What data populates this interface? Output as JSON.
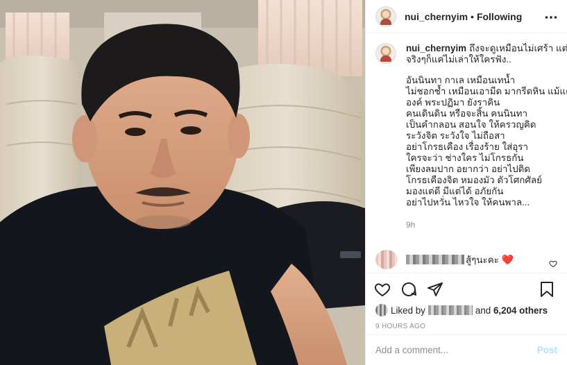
{
  "post": {
    "username": "nui_chernyim",
    "separator": "•",
    "follow_state": "Following",
    "caption": {
      "username": "nui_chernyim",
      "intro": "ถึงจะดูเหมือนไม่เศร้า แต่ จริงๆก็แค่ไม่เล่าให้ใครฟัง..",
      "lines": [
        "อันนินทา กาเล เหมือนเทน้ำ",
        "ไม่ชอกช้ำ เหมือนเอามีด มากรีดหิน แม้แต่",
        "องค์ พระปฏิมา ยังราคิน",
        "คนเดินดิน หรือจะสิ้น คนนินทา",
        "เป็นคำกลอน สอนใจ ให้ครวญคิด",
        "ระวังจิต ระวังใจ ไม่ถือสา",
        "อย่าโกรธเคือง เรื่องร้าย ใส่อุรา",
        "ใครจะว่า ช่างใคร ไม่โกรธกัน",
        "เพียงลมปาก อยากว่า อย่าไปติด",
        "โกรธเคืองจิต หมองมัว ตัวโศกศัลย์",
        "มองแต่ดี มีแต่ได้ อภัยกัน",
        "อย่าไปหวั่น ไหวใจ ให้คนพาล..."
      ],
      "time": "9h"
    },
    "reply": {
      "text": "สู้ๆนะคะ",
      "emoji": "❤️"
    },
    "likes": {
      "prefix": "Liked by",
      "connector": "and",
      "count": "6,204 others"
    },
    "timestamp": "9 HOURS AGO",
    "comment_box": {
      "placeholder": "Add a comment...",
      "post_label": "Post"
    }
  },
  "icons": {
    "more": "more-options-icon",
    "like": "heart-icon",
    "comment": "comment-icon",
    "share": "share-icon",
    "save": "bookmark-icon"
  },
  "colors": {
    "link_disabled": "#b2dffc",
    "muted": "#8e8e8e",
    "text": "#262626",
    "heart": "#ed4956"
  }
}
